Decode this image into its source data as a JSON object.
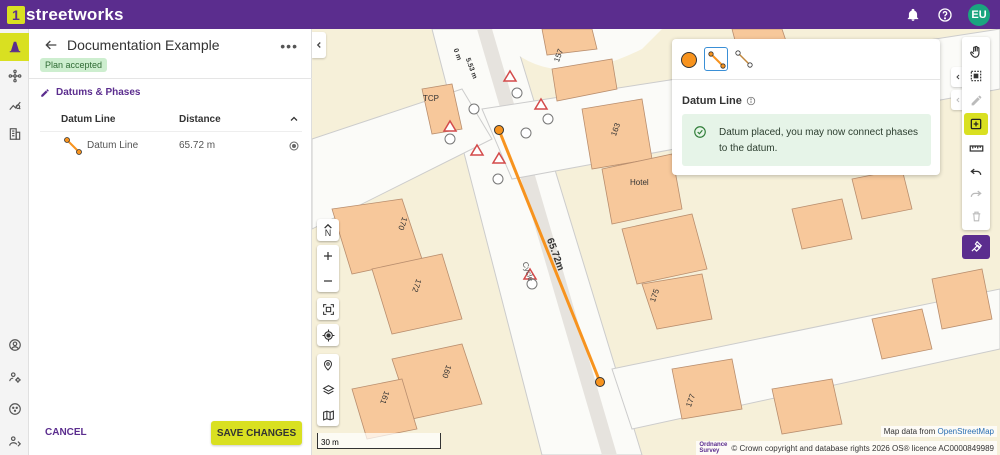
{
  "app": {
    "logo_glyph": "1",
    "logo_text": "streetworks",
    "brand_color": "#5b2d8e",
    "accent_color": "#d9e021",
    "user_initials": "EU"
  },
  "topbar": {
    "icons": [
      "bell-icon",
      "help-icon"
    ]
  },
  "rail": {
    "items": [
      "cone-icon",
      "network-icon",
      "analytics-icon",
      "building-icon",
      "account-icon",
      "user-settings-icon",
      "support-icon",
      "admin-icon"
    ]
  },
  "panel": {
    "title": "Documentation Example",
    "status": "Plan accepted",
    "section_title": "Datums & Phases",
    "columns": {
      "datum_line": "Datum Line",
      "distance": "Distance"
    },
    "rows": [
      {
        "label": "Datum Line",
        "distance": "65.72 m"
      }
    ],
    "cancel_label": "CANCEL",
    "save_label": "SAVE CHANGES"
  },
  "map": {
    "labels": {
      "tcp": "TCP",
      "hotel": "Hotel",
      "num_157": "157",
      "num_163": "163",
      "num_175": "175",
      "num_177": "177",
      "num_170": "170",
      "num_172": "172",
      "num_160": "160",
      "num_161": "161",
      "datum_length": "65.72m",
      "cycle": "Cycle",
      "small_measure": "5.53 m",
      "small_measure_prefix": "0 m"
    },
    "scale": "30 m",
    "attribution_prefix": "Map data from",
    "attribution_link": "OpenStreetMap",
    "copyright": "© Crown copyright and database rights 2026 OS® licence AC0000849989",
    "os_logo_line1": "Ordnance",
    "os_logo_line2": "Survey",
    "datum_color": "#f7931e",
    "controls": [
      "north-icon",
      "zoom-in-icon",
      "zoom-out-icon",
      "fit-bounds-icon",
      "locate-icon",
      "pin-icon",
      "layers-icon",
      "basemap-icon"
    ],
    "north_label": "N"
  },
  "tool_card": {
    "title": "Datum Line",
    "message": "Datum placed, you may now connect phases to the datum."
  },
  "right_toolbar": {
    "tools": [
      "pan-hand-icon",
      "select-area-icon",
      "edit-pencil-icon",
      "add-square-icon",
      "measure-ruler-icon",
      "undo-icon",
      "redo-icon",
      "delete-icon"
    ],
    "extra": "marker-icon"
  }
}
